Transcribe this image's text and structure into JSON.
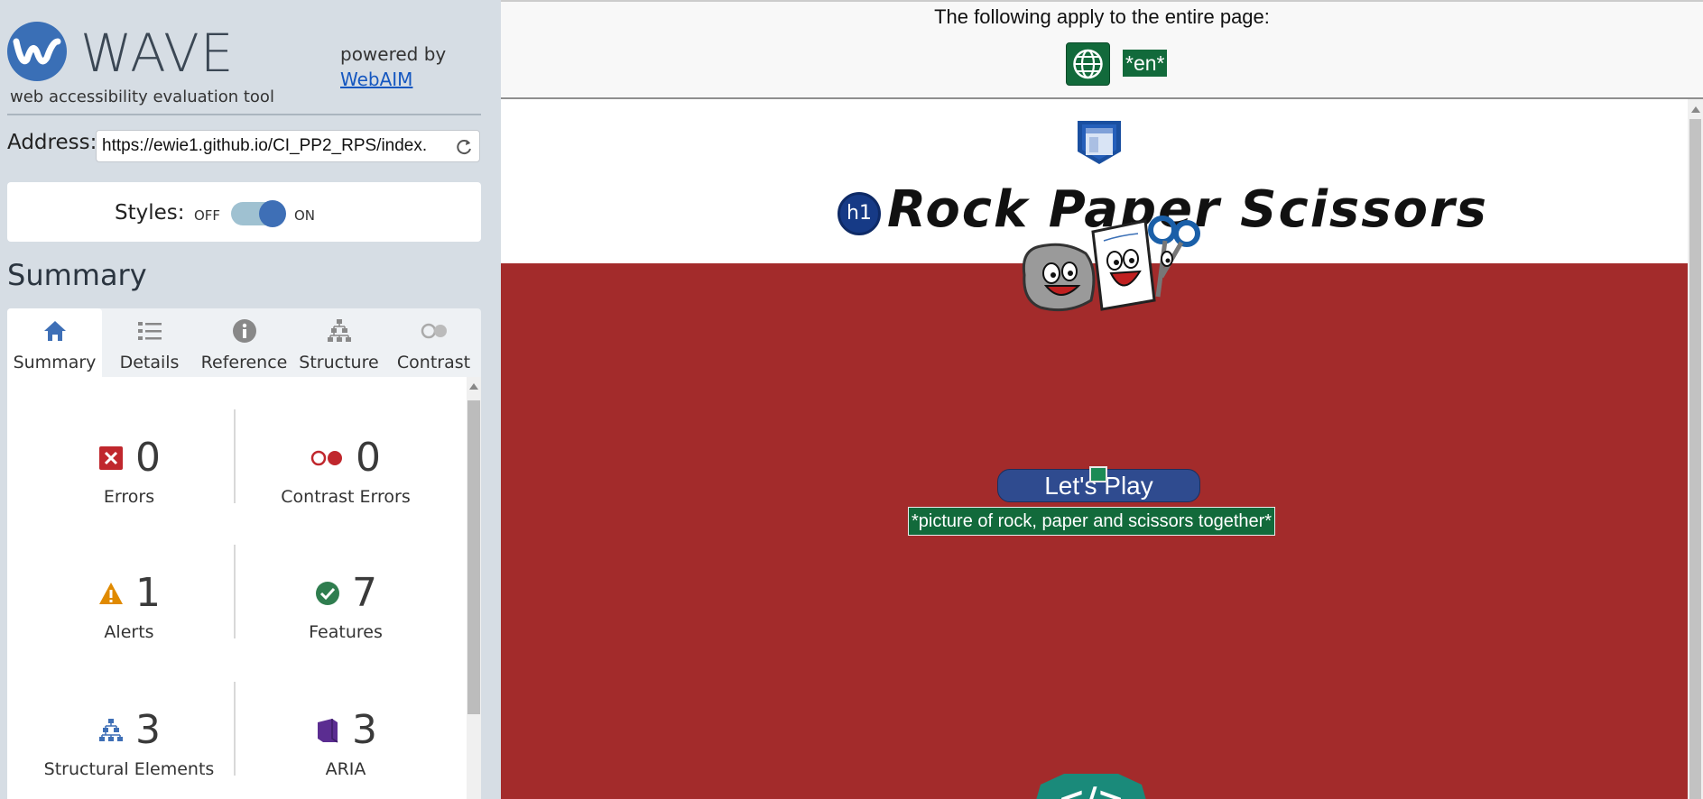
{
  "wave": {
    "logo_text": "WAVE",
    "tagline": "web accessibility evaluation tool",
    "powered_by": "powered by",
    "webaim_link": "WebAIM",
    "address_label": "Address:",
    "address_value": "https://ewie1.github.io/CI_PP2_RPS/index.",
    "styles_label": "Styles:",
    "styles_off": "OFF",
    "styles_on": "ON",
    "summary_heading": "Summary",
    "tabs": [
      {
        "label": "Summary",
        "icon": "home-icon",
        "active": true
      },
      {
        "label": "Details",
        "icon": "list-icon",
        "active": false
      },
      {
        "label": "Reference",
        "icon": "info-icon",
        "active": false
      },
      {
        "label": "Structure",
        "icon": "hierarchy-icon",
        "active": false
      },
      {
        "label": "Contrast",
        "icon": "contrast-icon",
        "active": false
      }
    ],
    "stats": [
      {
        "count": "0",
        "label": "Errors",
        "icon": "error-icon",
        "color": "#c0272d"
      },
      {
        "count": "0",
        "label": "Contrast Errors",
        "icon": "contrast-error-icon",
        "color": "#c0272d"
      },
      {
        "count": "1",
        "label": "Alerts",
        "icon": "alert-icon",
        "color": "#e08a00"
      },
      {
        "count": "7",
        "label": "Features",
        "icon": "feature-icon",
        "color": "#2f7d4f"
      },
      {
        "count": "3",
        "label": "Structural Elements",
        "icon": "structure-icon",
        "color": "#3e6fb6"
      },
      {
        "count": "3",
        "label": "ARIA",
        "icon": "aria-icon",
        "color": "#5b2d91"
      }
    ]
  },
  "page": {
    "bar_text": "The following apply to the entire page:",
    "lang_tag": "*en*",
    "h1_badge": "h1",
    "title": "Rock Paper Scissors",
    "play_button": "Let's Play",
    "alt_text": "*picture of rock, paper and scissors together*",
    "code_badge": "</>",
    "colors": {
      "main_bg": "#a32b2b",
      "button_bg": "#2f4b8f",
      "wave_green": "#126a3b"
    }
  }
}
